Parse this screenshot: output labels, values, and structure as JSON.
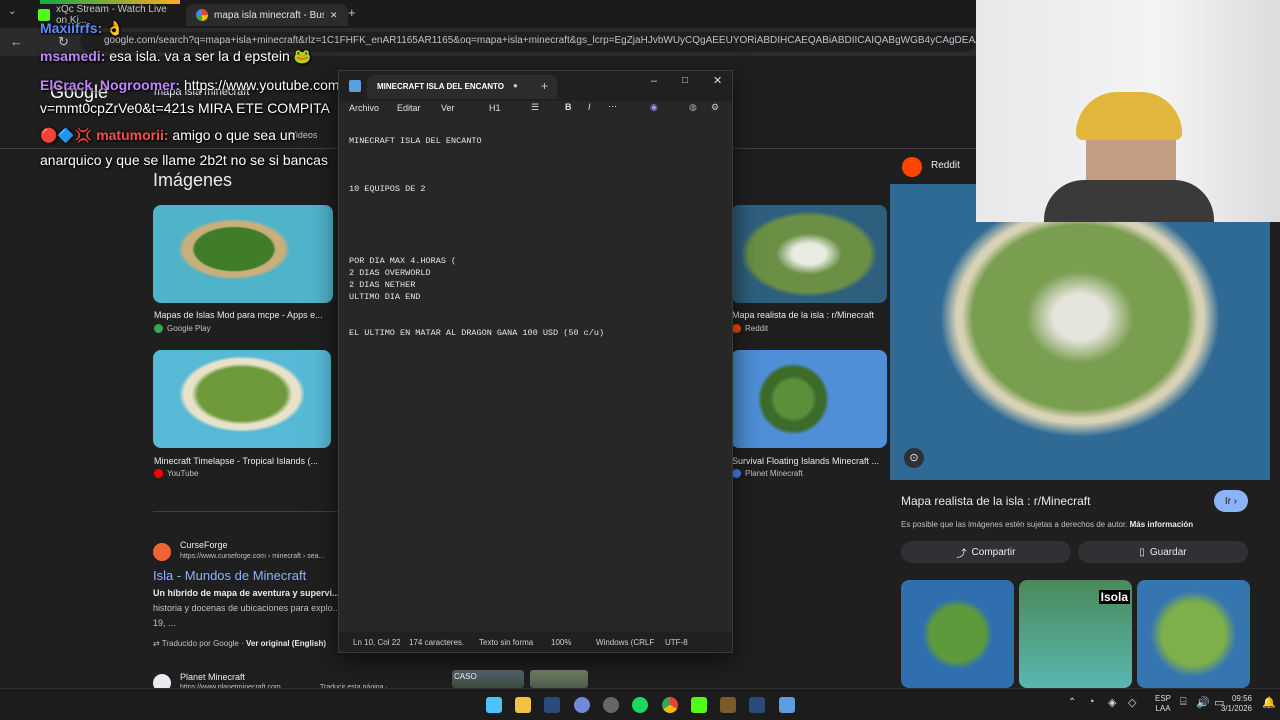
{
  "browser": {
    "tabs": [
      {
        "label": "xQc Stream - Watch Live on Ki...",
        "icon": "kick-icon"
      },
      {
        "label": "mapa isla minecraft - Buscar co...",
        "icon": "chrome-icon",
        "close": "✕"
      }
    ],
    "new_tab": "+",
    "url": "google.com/search?q=mapa+isla+minecraft&rlz=1C1FHFK_enAR1165AR1165&oq=mapa+isla+minecraft&gs_lcrp=EgZjaHJvbWUyCQgAEEUYORiABDIHCAEQABiABDIICAIQABgWGB4yCAgDEAAYFhgeMggIBBAAGBYYHjIICAU",
    "back": "←",
    "reload": "↻"
  },
  "google": {
    "logo": "Google",
    "query": "mapa isla minecraft",
    "videos_tab": "Videos",
    "images_heading": "Imágenes",
    "results": [
      {
        "title": "Mapas de Islas Mod para mcpe - Apps e...",
        "source": "Google Play"
      },
      {
        "title": "Minecraft Timelapse - Tropical Islands (...",
        "source": "YouTube"
      },
      {
        "title": "Mapa realista de la isla : r/Minecraft",
        "source": "Reddit"
      },
      {
        "title": "Survival Floating Islands Minecraft ...",
        "source": "Planet Minecraft"
      }
    ],
    "web_result": {
      "site": "CurseForge",
      "url": "https://www.curseforge.com › minecraft › sea...",
      "title": "Isla - Mundos de Minecraft",
      "snippet_bold": "Un híbrido de mapa de aventura y supervi...",
      "snippet": "historia y docenas de ubicaciones para explo...",
      "snippet2": "19, ...",
      "translated": "Traducido por Google ·",
      "original": "Ver original (English)"
    },
    "web_result2": {
      "site": "Planet Minecraft",
      "url": "https://www.planetminecraft.com",
      "translate": "Traducir esta página ·"
    },
    "caso": "CASO"
  },
  "chat": [
    {
      "name": "Maxiifrfs:",
      "msg": "",
      "color": "#5b8cff"
    },
    {
      "name": "msamedi:",
      "msg": "esa isla. va a ser la d epstein",
      "color": "#c084fc"
    },
    {
      "name": "ElCrack_Nogroomer:",
      "msg": "https://www.youtube.com/",
      "color": "#c084fc"
    },
    {
      "name": "",
      "msg": "v=mmt0cpZrVe0&t=421s MIRA ETE COMPITA",
      "color": "#ffffff"
    },
    {
      "name": "matumorii:",
      "msg": "amigo o que sea un",
      "color": "#ff4d4d"
    },
    {
      "name": "",
      "msg": "anarquico y que se llame 2b2t no se si bancas",
      "color": "#ffffff"
    }
  ],
  "notepad": {
    "title": "MINECRAFT ISLA DEL ENCANTO",
    "menu": {
      "file": "Archivo",
      "edit": "Editar",
      "view": "Ver",
      "heading": "H1"
    },
    "content": "MINECRAFT ISLA DEL ENCANTO\n\n\n\n10 EQUIPOS DE 2\n\n\n\n\n\nPOR DIA MAX 4.HORAS (\n2 DIAS OVERWORLD\n2 DIAS NETHER\nULTIMO DIA END\n\n\nEL ULTIMO EN MATAR AL DRAGON GANA 100 USD (50 c/u)",
    "status": {
      "position": "Ln 10, Col 22",
      "chars": "174 caracteres.",
      "format": "Texto sin forma",
      "zoom": "100%",
      "eol": "Windows (CRLF",
      "encoding": "UTF-8"
    }
  },
  "right_panel": {
    "source": "Reddit",
    "title": "Mapa realista de la isla : r/Minecraft",
    "go": "Ir ›",
    "copyright": "Es posible que las imágenes estén sujetas a derechos de autor.",
    "more_info": "Más información",
    "share": "Compartir",
    "save": "Guardar",
    "thumb_label": "Isola"
  },
  "taskbar": {
    "lang": "ESP",
    "lang2": "LAA",
    "time": "09:56",
    "date": "3/1/2026"
  }
}
